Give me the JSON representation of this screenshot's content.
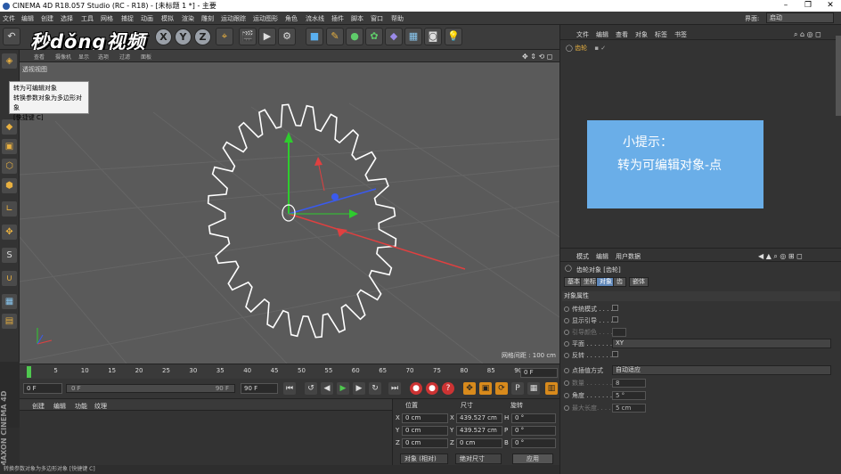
{
  "title_bar": {
    "title": "CINEMA 4D R18.057 Studio (RC - R18) - [未标题 1 *] - 主要",
    "minimize": "–",
    "restore": "❐",
    "close": "✕"
  },
  "menu": {
    "items": [
      "文件",
      "编辑",
      "创建",
      "选择",
      "工具",
      "网格",
      "捕捉",
      "动画",
      "模拟",
      "渲染",
      "雕刻",
      "运动跟踪",
      "运动图形",
      "角色",
      "流水线",
      "插件",
      "脚本",
      "窗口",
      "帮助"
    ],
    "layout_label": "界面:",
    "layout_value": "启动"
  },
  "watermark": "秒dǒng视频",
  "toolbar": {
    "axes": [
      "X",
      "Y",
      "Z"
    ]
  },
  "viewport": {
    "header_items": [
      "查看",
      "摄像机",
      "显示",
      "选项",
      "过滤",
      "面板"
    ],
    "view_label": "透视视图",
    "grid_spacing": "网格间距 : 100 cm"
  },
  "tooltip": {
    "title": "转为可编辑对象",
    "desc": "转换参数对象为多边形对象",
    "shortcut": "[快捷键 C]"
  },
  "timeline": {
    "ticks": [
      "0",
      "5",
      "10",
      "15",
      "20",
      "25",
      "30",
      "35",
      "40",
      "45",
      "50",
      "55",
      "60",
      "65",
      "70",
      "75",
      "80",
      "85",
      "90"
    ],
    "current_frame": "0 F"
  },
  "transport": {
    "start": "0 F",
    "slider_start": "0 F",
    "slider_end": "90 F",
    "end": "90 F"
  },
  "material": {
    "menu": [
      "创建",
      "编辑",
      "功能",
      "纹理"
    ]
  },
  "brand": "MAXON CINEMA 4D",
  "coords": {
    "headers": {
      "position": "位置",
      "size": "尺寸",
      "rotation": "旋转"
    },
    "rows": [
      {
        "axis": "X",
        "pos": "0 cm",
        "size_axis": "X",
        "size": "439.527 cm",
        "rot_axis": "H",
        "rot": "0 °"
      },
      {
        "axis": "Y",
        "pos": "0 cm",
        "size_axis": "Y",
        "size": "439.527 cm",
        "rot_axis": "P",
        "rot": "0 °"
      },
      {
        "axis": "Z",
        "pos": "0 cm",
        "size_axis": "Z",
        "size": "0 cm",
        "rot_axis": "B",
        "rot": "0 °"
      }
    ],
    "mode": "对象 (相对)",
    "size_mode": "绝对尺寸",
    "apply": "应用"
  },
  "status": "转换参数对象为多边形对象 [快捷键 C]",
  "object_manager": {
    "menu": [
      "文件",
      "编辑",
      "查看",
      "对象",
      "标签",
      "书签"
    ],
    "object_name": "齿轮"
  },
  "tip": {
    "line1": "小提示：",
    "line2": "转为可编辑对象-点"
  },
  "attributes": {
    "menu": [
      "模式",
      "编辑",
      "用户数据"
    ],
    "title": "齿轮对象 [齿轮]",
    "tabs": [
      "基本",
      "坐标",
      "对象",
      "齿",
      "嵌体"
    ],
    "section": "对象属性",
    "props": [
      {
        "label": "传统模式 . . . ."
      },
      {
        "label": "显示引导 . . . ."
      },
      {
        "label": "引导颜色 . . . ."
      },
      {
        "label": "平面 . . . . . . .",
        "value": "XY"
      },
      {
        "label": "反转 . . . . . . ."
      },
      {
        "label": "点插值方式",
        "value": "自动适应"
      },
      {
        "label": "数量 . . . . . . .",
        "value": "8"
      },
      {
        "label": "角度 . . . . . . .",
        "value": "5 °"
      },
      {
        "label": "最大长度. . . .",
        "value": "5 cm"
      }
    ]
  }
}
